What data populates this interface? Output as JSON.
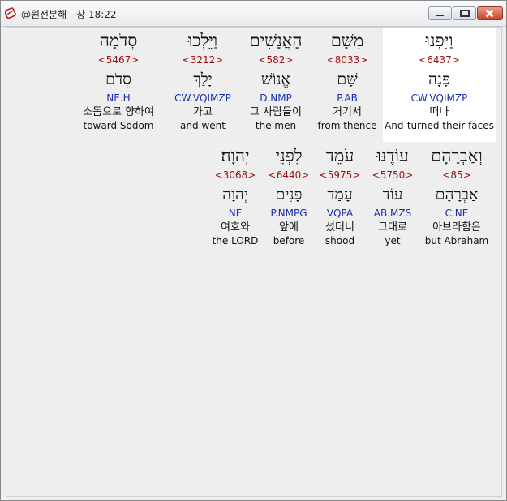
{
  "window": {
    "title": "@원전분해 - 창 18:22",
    "app_icon": "bible-app-icon",
    "buttons": [
      "minimize",
      "maximize",
      "close"
    ]
  },
  "rows": [
    [
      {
        "hebrew": "וַיִּפְנוּ",
        "strong": "<6437>",
        "lemma": "פָּנָה",
        "morph": "CW.VQIMZP",
        "korean": "떠나",
        "english": "And-turned their faces"
      },
      {
        "hebrew": "מִשָּׁם",
        "strong": "<8033>",
        "lemma": "שָׁם",
        "morph": "P.AB",
        "korean": "거기서",
        "english": "from thence"
      },
      {
        "hebrew": "הָאֲנָשִׁים",
        "strong": "<582>",
        "lemma": "אֱנוֹשׁ",
        "morph": "D.NMP",
        "korean": "그 사람들이",
        "english": "the men"
      },
      {
        "hebrew": "וַיֵּלְכוּ",
        "strong": "<3212>",
        "lemma": "יָלַךְ",
        "morph": "CW.VQIMZP",
        "korean": "가고",
        "english": "and went"
      },
      {
        "hebrew": "סְדֹמָה",
        "strong": "<5467>",
        "lemma": "סְדֹם",
        "morph": "NE.H",
        "korean": "소돔으로 향하여",
        "english": "toward Sodom"
      }
    ],
    [
      {
        "hebrew": "וְאַבְרָהָם",
        "strong": "<85>",
        "lemma": "אַבְרָהָם",
        "morph": "C.NE",
        "korean": "아브라함은",
        "english": "but Abraham"
      },
      {
        "hebrew": "עוֹדֶנּוּ",
        "strong": "<5750>",
        "lemma": "עוֹד",
        "morph": "AB.MZS",
        "korean": "그대로",
        "english": "yet"
      },
      {
        "hebrew": "עֹמֵד",
        "strong": "<5975>",
        "lemma": "עָמַד",
        "morph": "VQPA",
        "korean": "섰더니",
        "english": "shood"
      },
      {
        "hebrew": "לִפְנֵי",
        "strong": "<6440>",
        "lemma": "פָּנִים",
        "morph": "P.NMPG",
        "korean": "앞에",
        "english": "before"
      },
      {
        "hebrew": "יְהוָה׃",
        "strong": "<3068>",
        "lemma": "יְהוָה",
        "morph": "NE",
        "korean": "여호와",
        "english": "the LORD"
      }
    ]
  ]
}
